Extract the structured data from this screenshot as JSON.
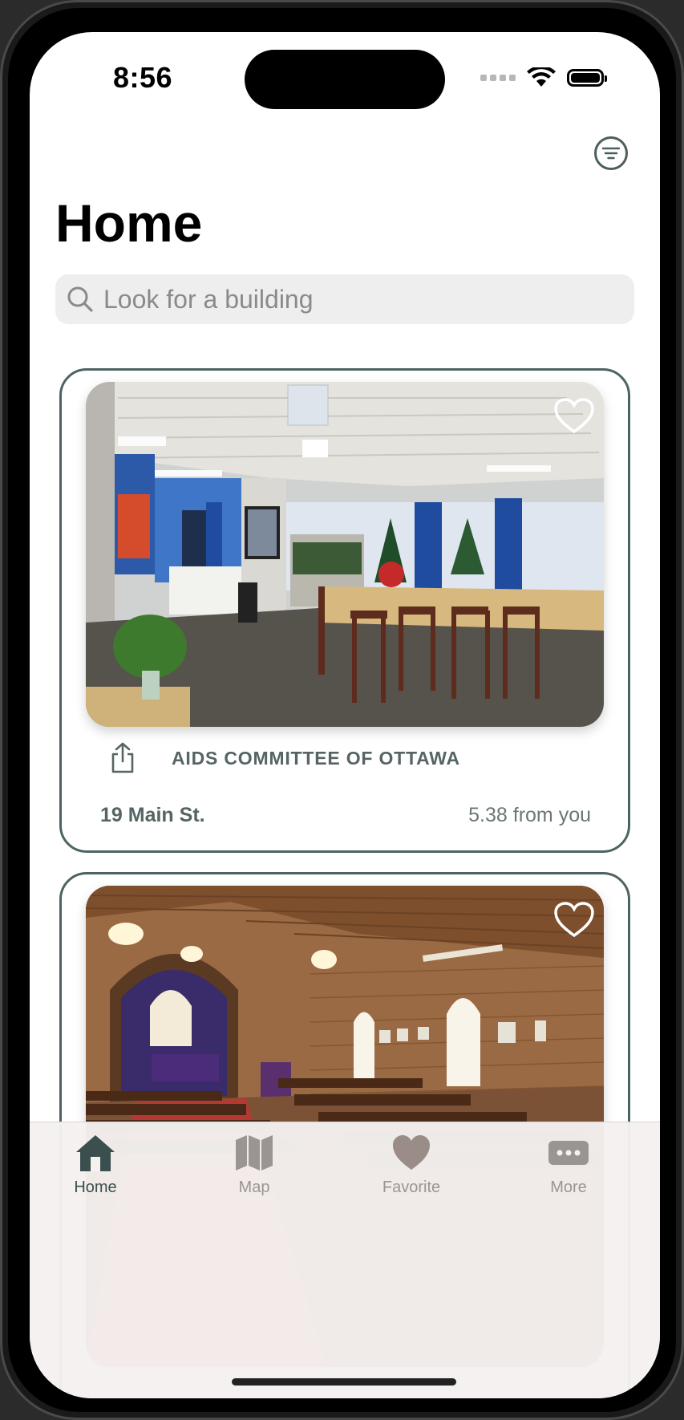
{
  "status_bar": {
    "time": "8:56"
  },
  "header": {
    "title": "Home",
    "filter_icon": "filter-lines-icon"
  },
  "search": {
    "placeholder": "Look for a building",
    "icon": "search-icon"
  },
  "buildings": [
    {
      "name": "AIDS COMMITTEE OF OTTAWA",
      "address": "19 Main St.",
      "distance": "5.38 from you",
      "favorite": false,
      "photo": "community-centre-interior-photo"
    },
    {
      "name": "",
      "address": "",
      "distance": "",
      "favorite": false,
      "photo": "church-interior-photo"
    }
  ],
  "tab_bar": {
    "items": [
      {
        "label": "Home",
        "icon": "house-icon",
        "active": true
      },
      {
        "label": "Map",
        "icon": "map-icon",
        "active": false
      },
      {
        "label": "Favorite",
        "icon": "heart-icon",
        "active": false
      },
      {
        "label": "More",
        "icon": "ellipsis-icon",
        "active": false
      }
    ]
  },
  "colors": {
    "accent": "#4d6363",
    "tab_active": "#3c4f4f",
    "tab_inactive": "#9a9593",
    "search_bg": "#eeeeee"
  }
}
